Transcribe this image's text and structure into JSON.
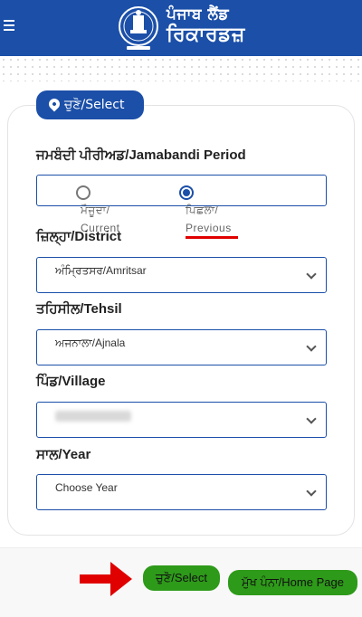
{
  "header": {
    "brand_line1": "ਪੰਜਾਬ ਲੈਂਡ",
    "brand_line2": "ਰਿਕਾਰਡਜ਼",
    "color": "#1b4fa8"
  },
  "form": {
    "select_pill": "ਚੁਣੋ/Select",
    "jamabandi_label": "ਜਮਬੰਦੀ ਪੀਰੀਅਡ/Jamabandi Period",
    "radio_current": "ਮੌਜੂਦਾ/ Current",
    "radio_previous": "ਪਿਛਲਾ/ Previous",
    "radio_selected": "previous",
    "district_label": "ਜ਼ਿਲ੍ਹਾ/District",
    "district_value": "ਅੰਮ੍ਰਿਤਸਰ/Amritsar",
    "tehsil_label": "ਤਹਿਸੀਲ/Tehsil",
    "tehsil_value": "ਅਜਨਾਲਾ/Ajnala",
    "village_label": "ਪਿੰਡ/Village",
    "year_label": "ਸਾਲ/Year",
    "year_placeholder": "Choose Year"
  },
  "bottom": {
    "select_button": "ਚੁਣੋ/Select",
    "home_button": "ਮੁੱਖ ਪੰਨਾ/Home Page",
    "button_color": "#2e9a1a",
    "annotation_color": "#e00000"
  }
}
